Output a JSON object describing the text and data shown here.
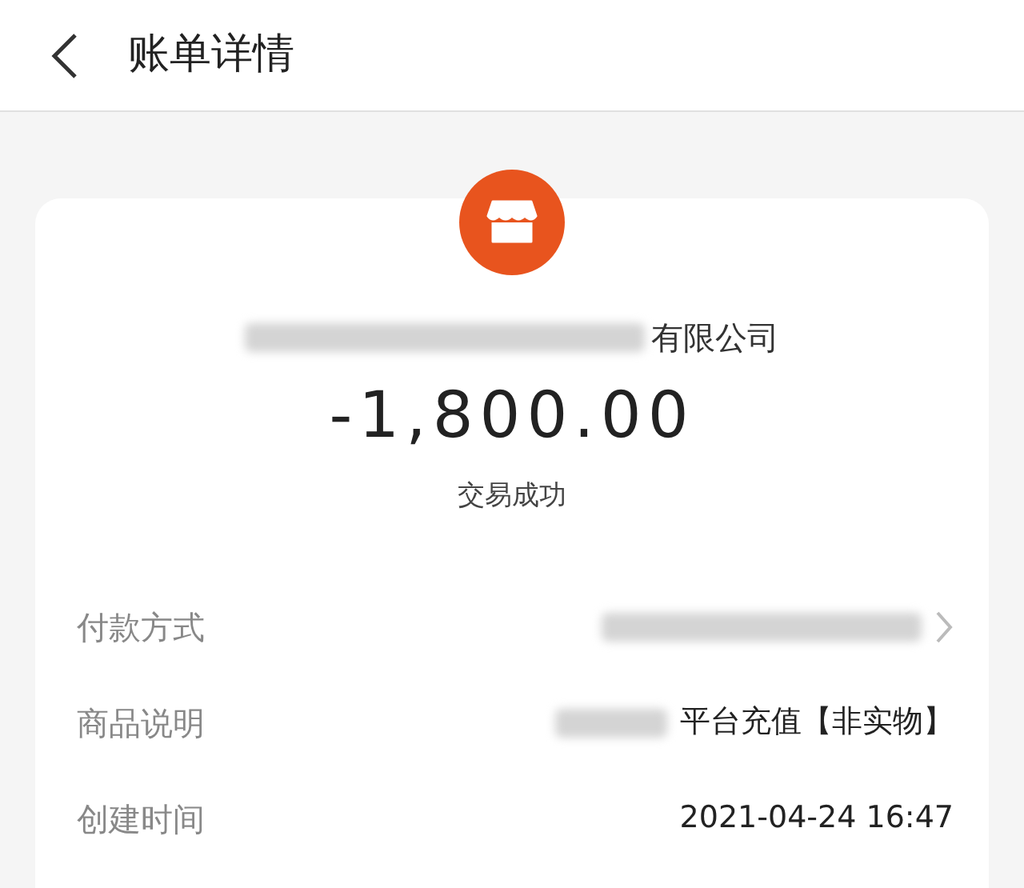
{
  "header": {
    "title": "账单详情"
  },
  "merchant": {
    "name": "有限公司",
    "redacted": true
  },
  "amount": "-1,800.00",
  "status": "交易成功",
  "details": [
    {
      "label": "付款方式",
      "redacted": true,
      "link": true
    },
    {
      "label": "商品说明",
      "value": "平台充值【非实物】",
      "redacted": true,
      "link": false
    },
    {
      "label": "创建时间",
      "value": "2021-04-24 16:47",
      "redacted": false,
      "link": false
    }
  ]
}
